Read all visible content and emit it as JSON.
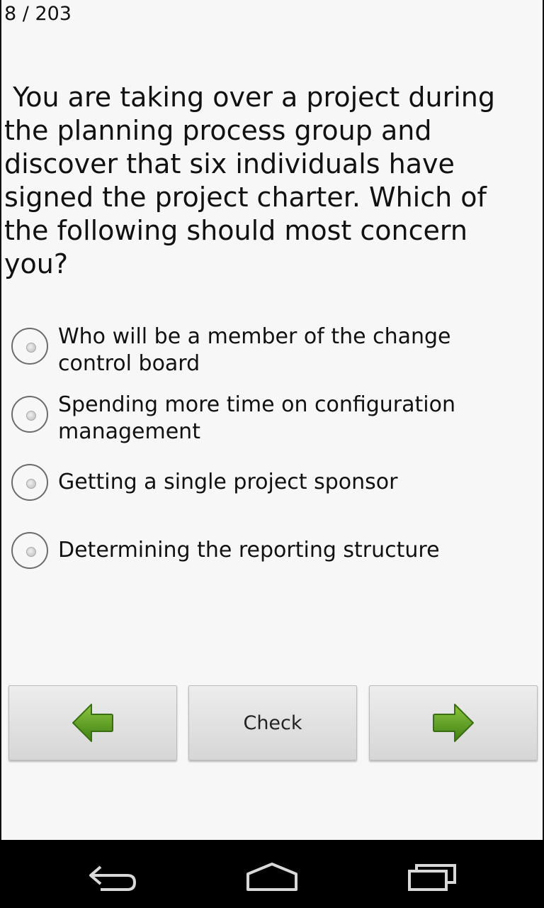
{
  "counter": "8 / 203",
  "question": " You are taking over a project during the planning process group and discover that six individuals have signed the project charter. Which of the following should most concern you?",
  "options": [
    {
      "label": "Who will be a member of the change control board",
      "selected": false
    },
    {
      "label": "Spending more time on configuration management",
      "selected": false
    },
    {
      "label": "Getting a single project sponsor",
      "selected": false
    },
    {
      "label": "Determining the reporting structure",
      "selected": false
    }
  ],
  "buttons": {
    "prev_icon": "arrow-left-icon",
    "check_label": "Check",
    "next_icon": "arrow-right-icon"
  },
  "navbar": {
    "back_icon": "back-icon",
    "home_icon": "home-icon",
    "recents_icon": "recent-apps-icon"
  },
  "colors": {
    "arrow_green": "#5a9a1e",
    "background": "#f7f7f7"
  }
}
